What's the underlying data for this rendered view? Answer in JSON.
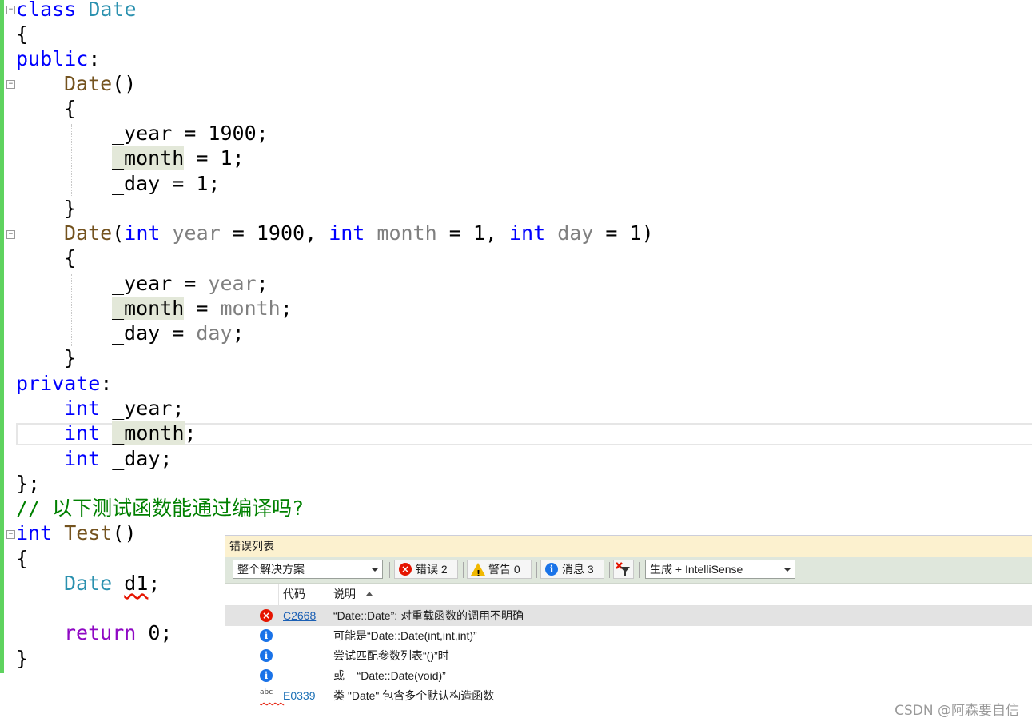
{
  "editor": {
    "lines": [
      [
        "class ",
        "Date"
      ],
      [
        "{"
      ],
      [
        "public",
        ":"
      ],
      [
        "Date",
        "()"
      ],
      [
        "{"
      ],
      [
        "_year = 1900;"
      ],
      [
        "_month",
        " = 1;"
      ],
      [
        "_day = 1;"
      ],
      [
        "}"
      ],
      [
        "Date",
        "(",
        "int",
        " ",
        "year",
        " = 1900, ",
        "int",
        " ",
        "month",
        " = 1, ",
        "int",
        " ",
        "day",
        " = 1)"
      ],
      [
        "{"
      ],
      [
        "_year = ",
        "year",
        ";"
      ],
      [
        "_month",
        " = ",
        "month",
        ";"
      ],
      [
        "_day = ",
        "day",
        ";"
      ],
      [
        "}"
      ],
      [
        "private",
        ":"
      ],
      [
        "int",
        " _year;"
      ],
      [
        "int",
        " ",
        "_month",
        ";"
      ],
      [
        "int",
        " _day;"
      ],
      [
        "};"
      ],
      [
        "// 以下测试函数能通过编译吗?"
      ],
      [
        "int",
        " ",
        "Test",
        "()"
      ],
      [
        "{"
      ],
      [
        "Date",
        " ",
        "d1",
        ";"
      ],
      [
        ""
      ],
      [
        "return",
        " 0;"
      ],
      [
        "}"
      ]
    ]
  },
  "error_list": {
    "title": "错误列表",
    "scope_dropdown": "整个解决方案",
    "errors_button": "错误 2",
    "warnings_button": "警告 0",
    "messages_button": "消息 3",
    "source_dropdown": "生成 + IntelliSense",
    "col_code": "代码",
    "col_desc": "说明",
    "rows": [
      {
        "icon": "error-icon",
        "code": "C2668",
        "desc": "“Date::Date”: 对重载函数的调用不明确"
      },
      {
        "icon": "info-icon",
        "code": "",
        "desc": "可能是“Date::Date(int,int,int)”"
      },
      {
        "icon": "info-icon",
        "code": "",
        "desc": "尝试匹配参数列表“()”时"
      },
      {
        "icon": "info-icon",
        "code": "",
        "desc": "或    “Date::Date(void)”"
      },
      {
        "icon": "spelling-icon",
        "code": "E0339",
        "desc": "类 \"Date\" 包含多个默认构造函数"
      }
    ],
    "abc_glyph": "abc"
  },
  "watermark": "CSDN @阿森要自信",
  "colors": {
    "keyword": "#0000ff",
    "class_name": "#2b91af",
    "function": "#74531f",
    "parameter": "#808080",
    "comment": "#008000",
    "control_keyword": "#8f08c4",
    "error_red": "#e51400",
    "info_blue": "#1a73e8",
    "warning_yellow": "#f0b800",
    "title_bg": "#fcf1cf",
    "toolbar_bg": "#dfe7dc"
  }
}
